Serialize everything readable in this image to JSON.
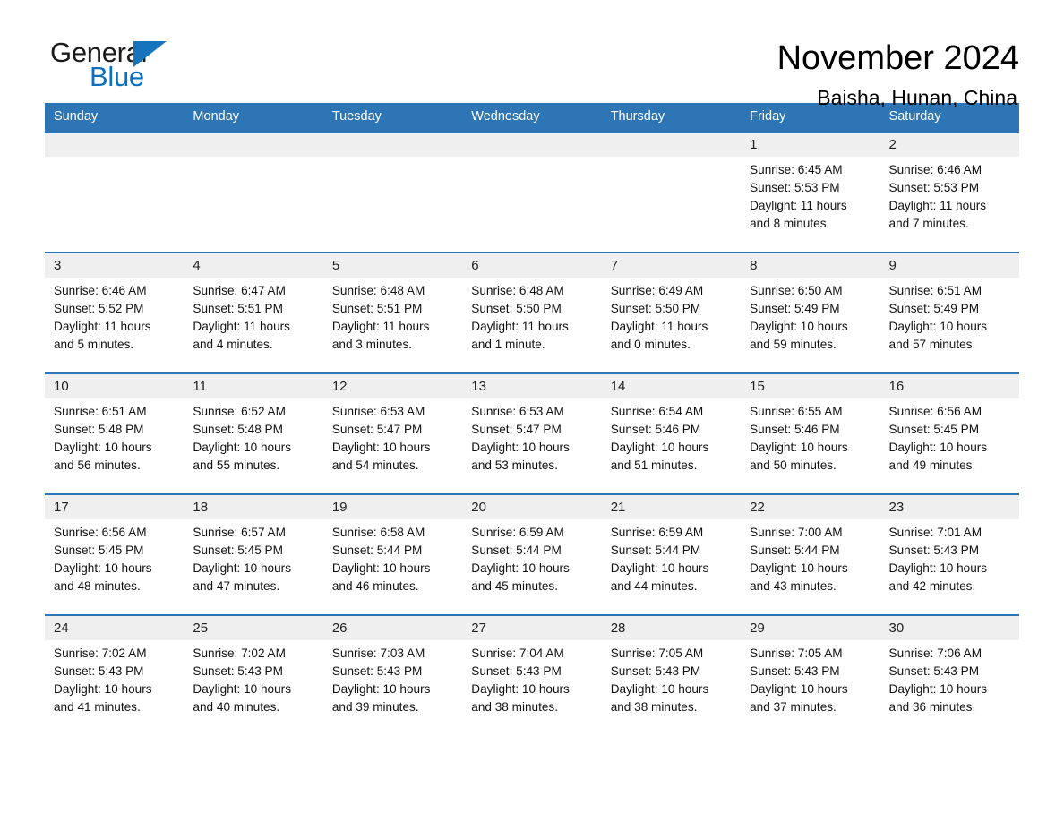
{
  "brand": {
    "name_part1": "General",
    "name_part2": "Blue",
    "accent_color": "#1574bb"
  },
  "header": {
    "title": "November 2024",
    "location": "Baisha, Hunan, China"
  },
  "theme": {
    "header_bg": "#2e75b6",
    "daynum_bg": "#efefef",
    "text": "#000000"
  },
  "weekday_headers": [
    "Sunday",
    "Monday",
    "Tuesday",
    "Wednesday",
    "Thursday",
    "Friday",
    "Saturday"
  ],
  "weeks": [
    [
      {
        "day": "",
        "info": ""
      },
      {
        "day": "",
        "info": ""
      },
      {
        "day": "",
        "info": ""
      },
      {
        "day": "",
        "info": ""
      },
      {
        "day": "",
        "info": ""
      },
      {
        "day": "1",
        "info": "Sunrise: 6:45 AM\nSunset: 5:53 PM\nDaylight: 11 hours\nand 8 minutes."
      },
      {
        "day": "2",
        "info": "Sunrise: 6:46 AM\nSunset: 5:53 PM\nDaylight: 11 hours\nand 7 minutes."
      }
    ],
    [
      {
        "day": "3",
        "info": "Sunrise: 6:46 AM\nSunset: 5:52 PM\nDaylight: 11 hours\nand 5 minutes."
      },
      {
        "day": "4",
        "info": "Sunrise: 6:47 AM\nSunset: 5:51 PM\nDaylight: 11 hours\nand 4 minutes."
      },
      {
        "day": "5",
        "info": "Sunrise: 6:48 AM\nSunset: 5:51 PM\nDaylight: 11 hours\nand 3 minutes."
      },
      {
        "day": "6",
        "info": "Sunrise: 6:48 AM\nSunset: 5:50 PM\nDaylight: 11 hours\nand 1 minute."
      },
      {
        "day": "7",
        "info": "Sunrise: 6:49 AM\nSunset: 5:50 PM\nDaylight: 11 hours\nand 0 minutes."
      },
      {
        "day": "8",
        "info": "Sunrise: 6:50 AM\nSunset: 5:49 PM\nDaylight: 10 hours\nand 59 minutes."
      },
      {
        "day": "9",
        "info": "Sunrise: 6:51 AM\nSunset: 5:49 PM\nDaylight: 10 hours\nand 57 minutes."
      }
    ],
    [
      {
        "day": "10",
        "info": "Sunrise: 6:51 AM\nSunset: 5:48 PM\nDaylight: 10 hours\nand 56 minutes."
      },
      {
        "day": "11",
        "info": "Sunrise: 6:52 AM\nSunset: 5:48 PM\nDaylight: 10 hours\nand 55 minutes."
      },
      {
        "day": "12",
        "info": "Sunrise: 6:53 AM\nSunset: 5:47 PM\nDaylight: 10 hours\nand 54 minutes."
      },
      {
        "day": "13",
        "info": "Sunrise: 6:53 AM\nSunset: 5:47 PM\nDaylight: 10 hours\nand 53 minutes."
      },
      {
        "day": "14",
        "info": "Sunrise: 6:54 AM\nSunset: 5:46 PM\nDaylight: 10 hours\nand 51 minutes."
      },
      {
        "day": "15",
        "info": "Sunrise: 6:55 AM\nSunset: 5:46 PM\nDaylight: 10 hours\nand 50 minutes."
      },
      {
        "day": "16",
        "info": "Sunrise: 6:56 AM\nSunset: 5:45 PM\nDaylight: 10 hours\nand 49 minutes."
      }
    ],
    [
      {
        "day": "17",
        "info": "Sunrise: 6:56 AM\nSunset: 5:45 PM\nDaylight: 10 hours\nand 48 minutes."
      },
      {
        "day": "18",
        "info": "Sunrise: 6:57 AM\nSunset: 5:45 PM\nDaylight: 10 hours\nand 47 minutes."
      },
      {
        "day": "19",
        "info": "Sunrise: 6:58 AM\nSunset: 5:44 PM\nDaylight: 10 hours\nand 46 minutes."
      },
      {
        "day": "20",
        "info": "Sunrise: 6:59 AM\nSunset: 5:44 PM\nDaylight: 10 hours\nand 45 minutes."
      },
      {
        "day": "21",
        "info": "Sunrise: 6:59 AM\nSunset: 5:44 PM\nDaylight: 10 hours\nand 44 minutes."
      },
      {
        "day": "22",
        "info": "Sunrise: 7:00 AM\nSunset: 5:44 PM\nDaylight: 10 hours\nand 43 minutes."
      },
      {
        "day": "23",
        "info": "Sunrise: 7:01 AM\nSunset: 5:43 PM\nDaylight: 10 hours\nand 42 minutes."
      }
    ],
    [
      {
        "day": "24",
        "info": "Sunrise: 7:02 AM\nSunset: 5:43 PM\nDaylight: 10 hours\nand 41 minutes."
      },
      {
        "day": "25",
        "info": "Sunrise: 7:02 AM\nSunset: 5:43 PM\nDaylight: 10 hours\nand 40 minutes."
      },
      {
        "day": "26",
        "info": "Sunrise: 7:03 AM\nSunset: 5:43 PM\nDaylight: 10 hours\nand 39 minutes."
      },
      {
        "day": "27",
        "info": "Sunrise: 7:04 AM\nSunset: 5:43 PM\nDaylight: 10 hours\nand 38 minutes."
      },
      {
        "day": "28",
        "info": "Sunrise: 7:05 AM\nSunset: 5:43 PM\nDaylight: 10 hours\nand 38 minutes."
      },
      {
        "day": "29",
        "info": "Sunrise: 7:05 AM\nSunset: 5:43 PM\nDaylight: 10 hours\nand 37 minutes."
      },
      {
        "day": "30",
        "info": "Sunrise: 7:06 AM\nSunset: 5:43 PM\nDaylight: 10 hours\nand 36 minutes."
      }
    ]
  ]
}
